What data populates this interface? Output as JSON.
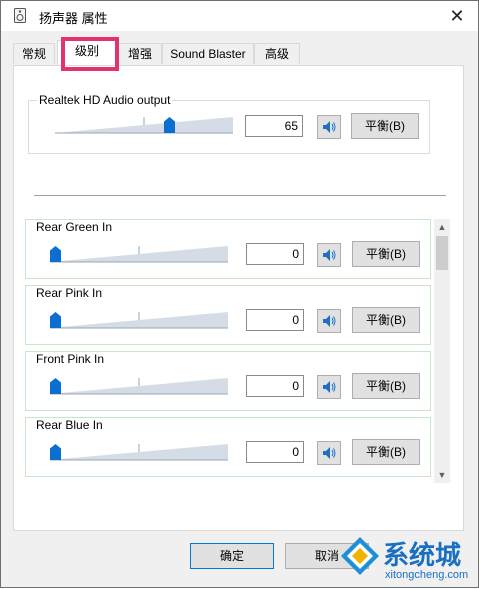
{
  "window": {
    "title": "扬声器 属性",
    "close_glyph": "✕"
  },
  "tabs": [
    {
      "label": "常规"
    },
    {
      "label": "级别",
      "active": true
    },
    {
      "label": "增强"
    },
    {
      "label": "Sound Blaster"
    },
    {
      "label": "高级"
    }
  ],
  "main_output": {
    "label": "Realtek HD Audio output",
    "value": "65",
    "level_percent": 65,
    "mute_icon": "speaker-icon",
    "balance_label": "平衡(B)"
  },
  "inputs": [
    {
      "label": "Rear Green In",
      "value": "0",
      "level_percent": 0,
      "balance_label": "平衡(B)"
    },
    {
      "label": "Rear Pink In",
      "value": "0",
      "level_percent": 0,
      "balance_label": "平衡(B)"
    },
    {
      "label": "Front Pink In",
      "value": "0",
      "level_percent": 0,
      "balance_label": "平衡(B)"
    },
    {
      "label": "Rear Blue In",
      "value": "0",
      "level_percent": 0,
      "balance_label": "平衡(B)"
    }
  ],
  "footer": {
    "ok_label": "确定",
    "cancel_label": "取消"
  },
  "watermark": {
    "brand": "系统城",
    "url": "xitongcheng.com"
  },
  "colors": {
    "accent": "#0a6fd1",
    "highlight": "#e2336a",
    "item_border": "#c8e6c8"
  }
}
